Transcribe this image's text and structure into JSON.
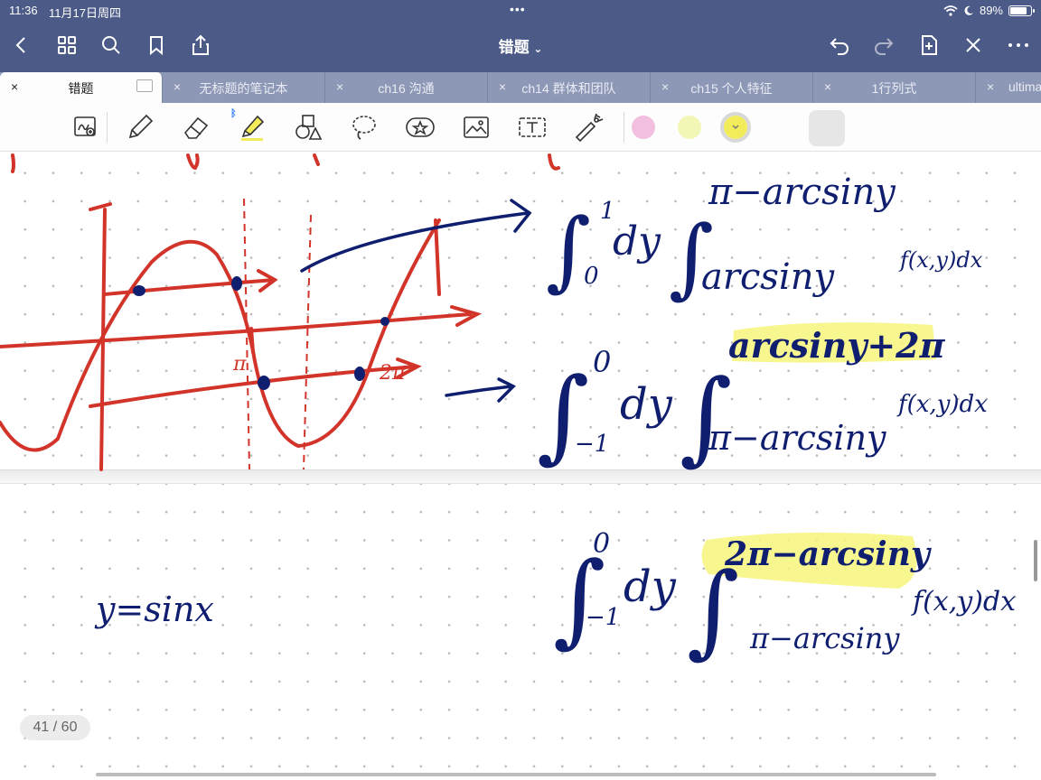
{
  "status": {
    "time": "11:36",
    "date": "11月17日周四",
    "dots": "•••",
    "battery": "89%",
    "battery_level": 0.89
  },
  "nav": {
    "title": "错题"
  },
  "tabs": [
    {
      "label": "错题",
      "active": true
    },
    {
      "label": "无标题的笔记本"
    },
    {
      "label": "ch16 沟通"
    },
    {
      "label": "ch14 群体和团队"
    },
    {
      "label": "ch15 个人特征"
    },
    {
      "label": "1行列式"
    },
    {
      "label": "ultima"
    }
  ],
  "toolbar": {
    "colors": [
      "#f2bfe0",
      "#f2f7b8",
      "#f2ec5a"
    ],
    "selected_color": "#f2ec5a"
  },
  "canvas": {
    "ink_color": "#0f1e6e",
    "graph_color": "#d2342a",
    "highlight_color": "#f7f57a",
    "formula1": {
      "int": "∫",
      "lower": "0",
      "upper": "1",
      "dy": "dy",
      "inner_upper": "π−arcsiny",
      "inner_lower": "arcsiny",
      "integrand": "f(x,y)dx"
    },
    "formula2": {
      "lower": "−1",
      "upper": "0",
      "dy": "dy",
      "inner_upper": "arcsiny+2π",
      "inner_lower": "π−arcsiny",
      "integrand": "f(x,y)dx"
    },
    "formula3": {
      "lower": "−1",
      "upper": "0",
      "dy": "dy",
      "inner_upper": "2π−arcsiny",
      "inner_lower": "π−arcsiny",
      "integrand": "f(x,y)dx"
    },
    "graph_labels": {
      "pi": "π",
      "two_pi": "2π"
    },
    "note": "y=sinx"
  },
  "page": {
    "indicator": "41 / 60"
  }
}
